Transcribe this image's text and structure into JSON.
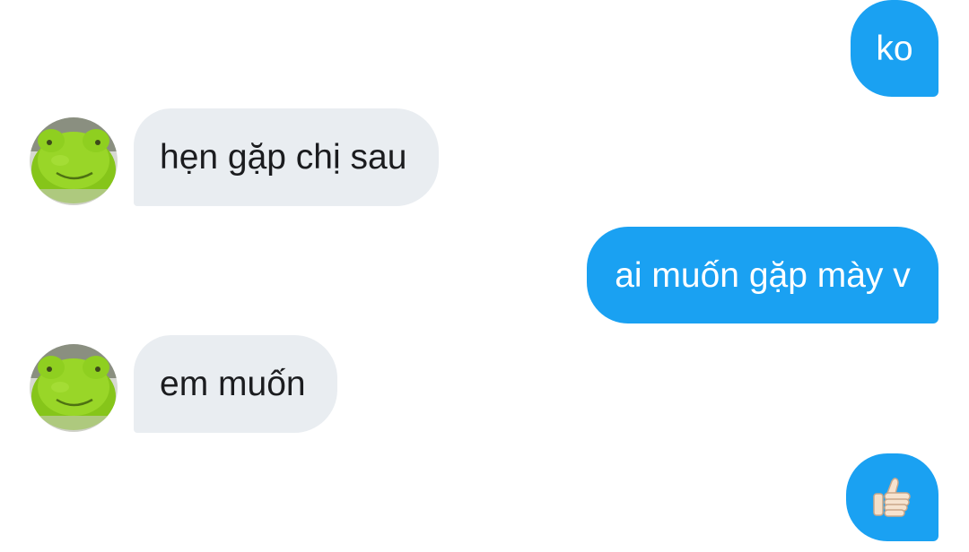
{
  "colors": {
    "outgoing_bubble": "#1aa1f2",
    "incoming_bubble": "#e9edf1",
    "incoming_text": "#1b1c1f",
    "outgoing_text": "#ffffff"
  },
  "messages": [
    {
      "sender": "me",
      "text": "ko"
    },
    {
      "sender": "other",
      "text": "hẹn gặp chị sau",
      "avatar_icon": "green-plush-frog-avatar"
    },
    {
      "sender": "me",
      "text": "ai muốn gặp mày v"
    },
    {
      "sender": "other",
      "text": "em muốn",
      "avatar_icon": "green-plush-frog-avatar"
    },
    {
      "sender": "me",
      "icon": "thumbs-up-icon"
    }
  ]
}
